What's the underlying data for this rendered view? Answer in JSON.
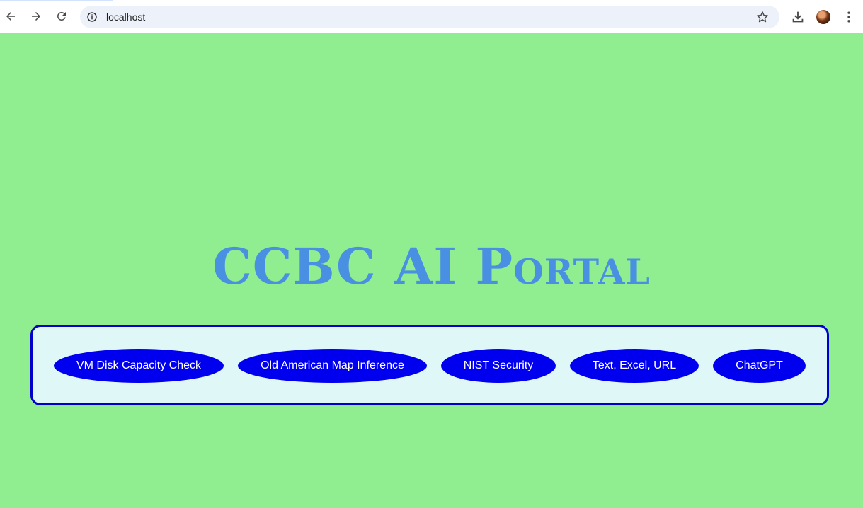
{
  "browser": {
    "url": "localhost",
    "icons": [
      "back-arrow-icon",
      "forward-arrow-icon",
      "reload-icon",
      "info-icon",
      "star-icon",
      "download-icon",
      "profile-avatar",
      "more-vert-icon"
    ]
  },
  "page": {
    "title": "CCBC AI Portal",
    "background_color": "#90ee90",
    "title_color": "#4a90e2",
    "panel_border_color": "#0000cd",
    "panel_bg_color": "#e0f7f7",
    "button_color": "#0000ee"
  },
  "buttons": [
    {
      "label": "VM Disk Capacity Check"
    },
    {
      "label": "Old American Map Inference"
    },
    {
      "label": "NIST Security"
    },
    {
      "label": "Text, Excel, URL"
    },
    {
      "label": "ChatGPT"
    }
  ]
}
